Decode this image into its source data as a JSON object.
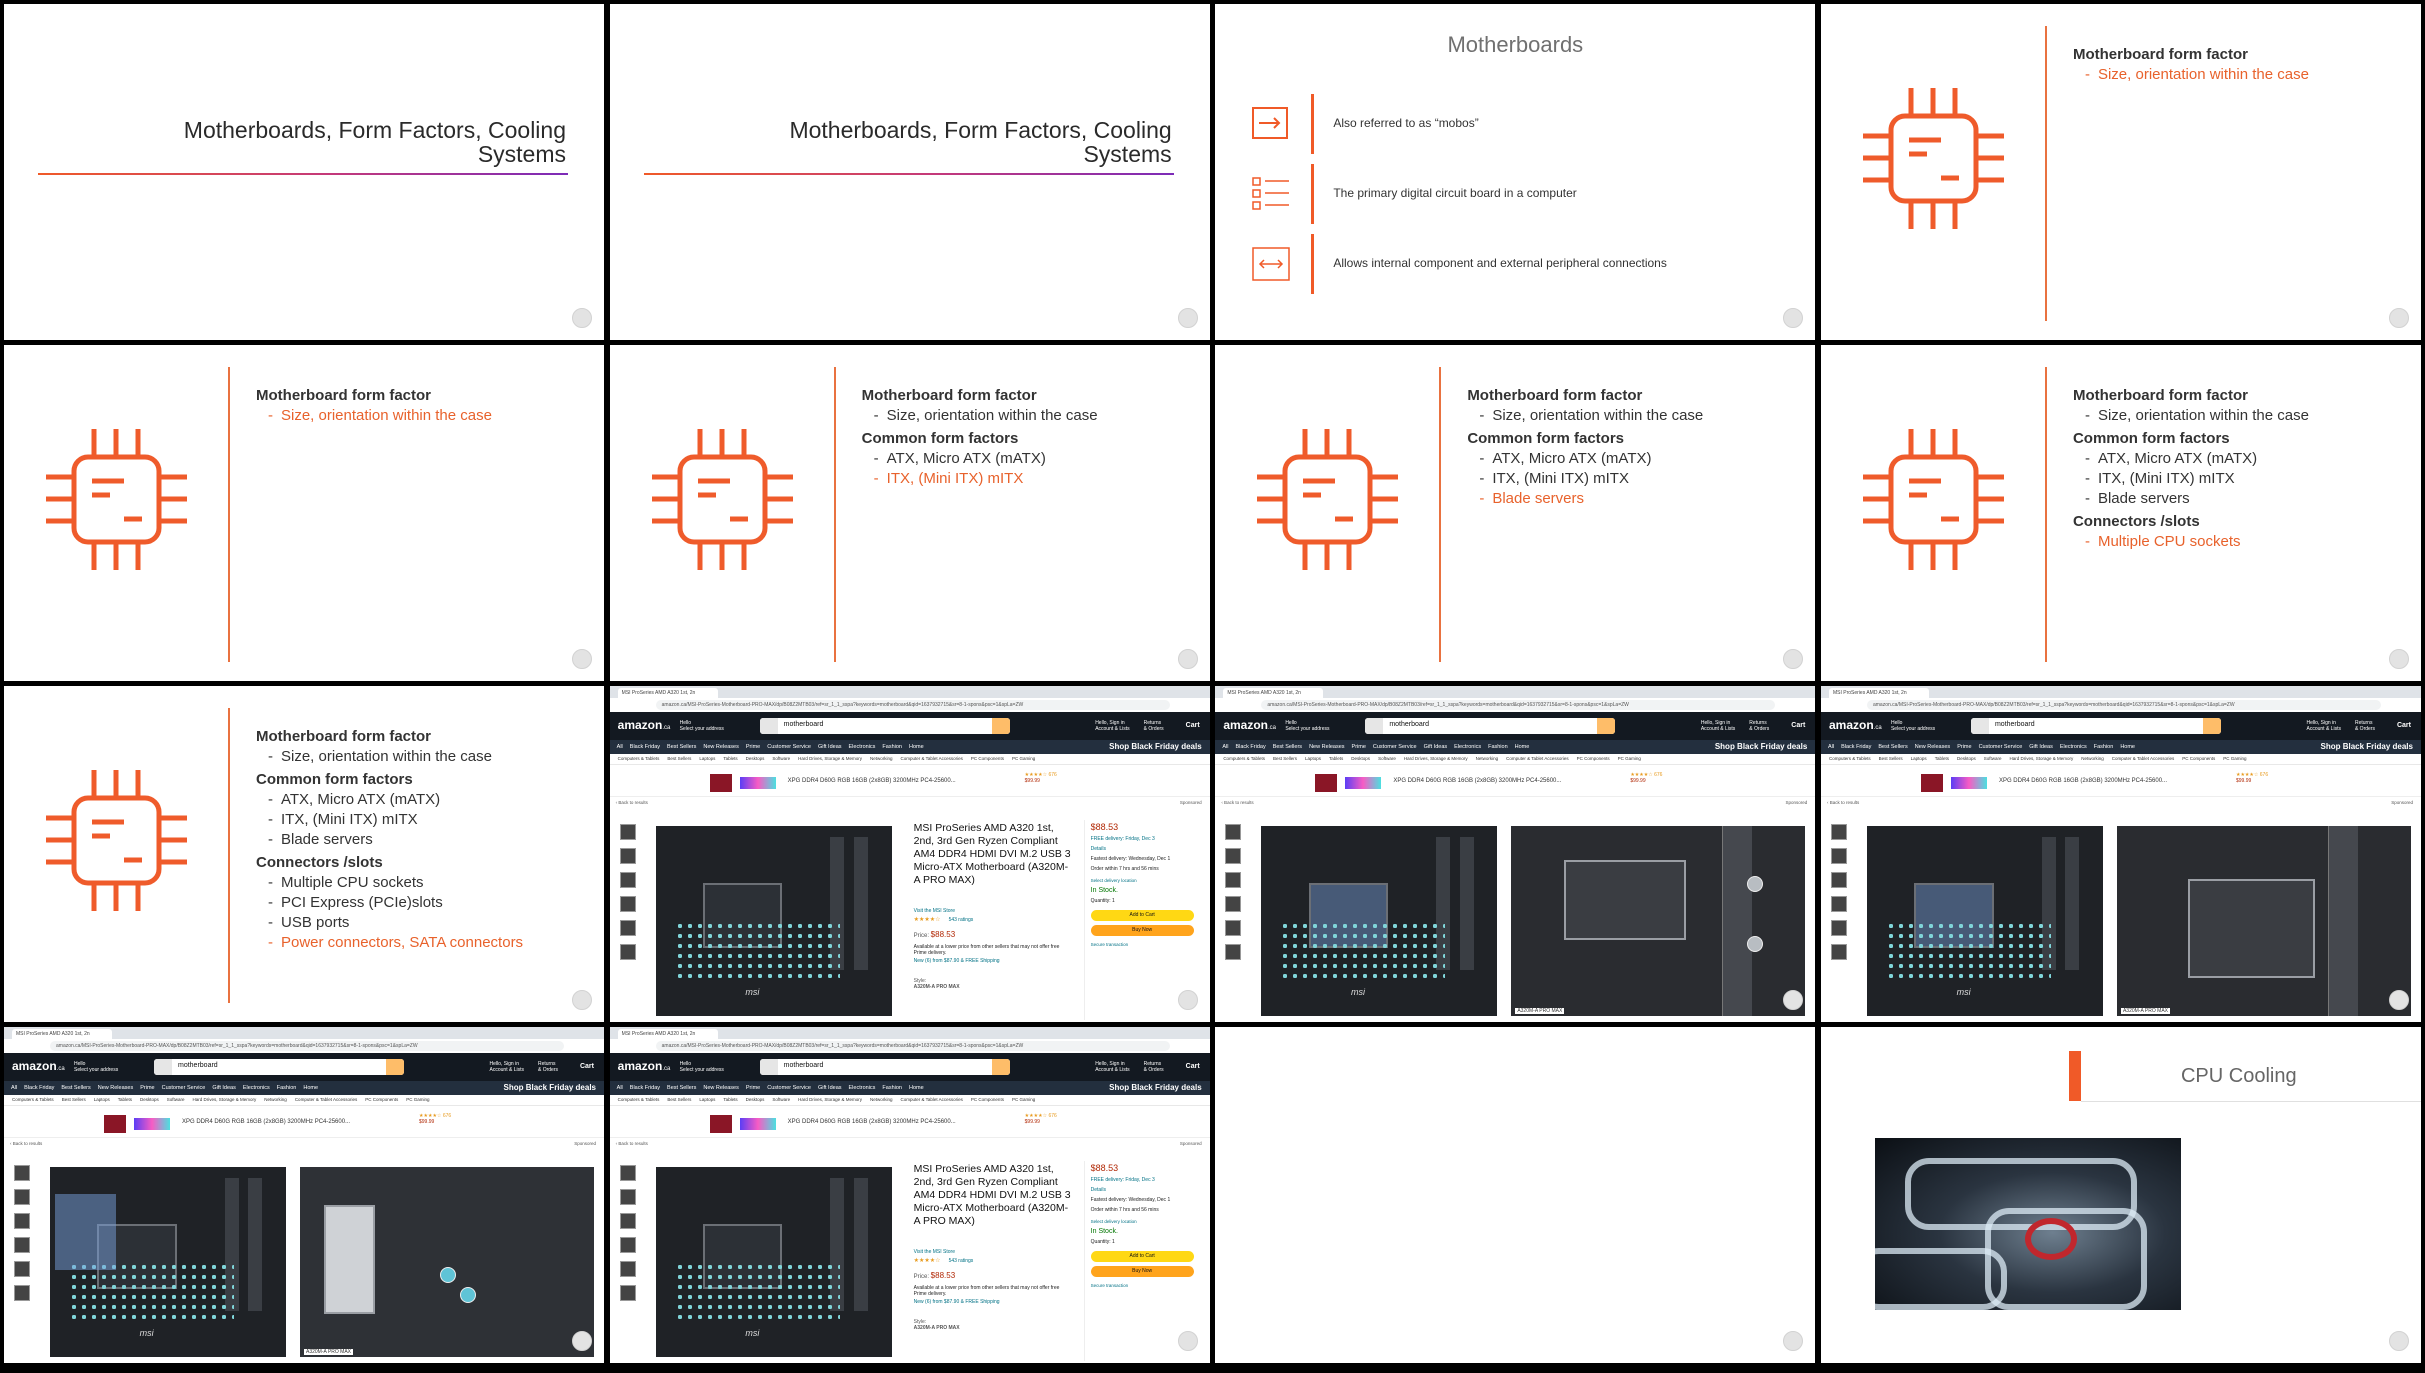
{
  "slides": {
    "title1": {
      "title": "Motherboards, Form Factors, Cooling Systems"
    },
    "title2": {
      "title": "Motherboards, Form Factors, Cooling Systems"
    },
    "motherboards": {
      "title": "Motherboards",
      "rows": [
        {
          "text": "Also referred to as “mobos”",
          "icon": "arrow-into-box-icon"
        },
        {
          "text": "The primary digital circuit board in a computer",
          "icon": "checklist-icon"
        },
        {
          "text": "Allows internal component and external peripheral connections",
          "icon": "double-arrow-icon"
        }
      ]
    },
    "bullets": {
      "h_form": "Motherboard form factor",
      "i_size": "Size, orientation within the case",
      "h_common": "Common form factors",
      "i_atx": "ATX, Micro ATX (mATX)",
      "i_itx": "ITX, (Mini ITX) mITX",
      "i_blade": "Blade servers",
      "h_conn": "Connectors /slots",
      "i_cpu": "Multiple CPU sockets",
      "i_pcie": "PCI Express (PCIe)slots",
      "i_usb": "USB ports",
      "i_power": "Power connectors, SATA connectors"
    },
    "cpu_cooling": {
      "title": "CPU Cooling"
    }
  },
  "browser": {
    "tab_title": "MSI ProSeries AMD A320 1st, 2n",
    "url": "amazon.ca/MSI-ProSeries-Motherboard-PRO-MAX/dp/B08Z2MTB03/ref=sr_1_1_sspa?keywords=motherboard&qid=1637932715&sr=8-1-spons&psc=1&spLa=ZW",
    "logo": "amazon",
    "logo_suffix": ".ca",
    "deliver_line1": "Hello",
    "deliver_line2": "Select your address",
    "search_category": "All",
    "search_query": "motherboard",
    "account_line1": "Hello, Sign in",
    "account_line2": "Account & Lists",
    "returns_line1": "Returns",
    "returns_line2": "& Orders",
    "cart": "Cart",
    "nav": [
      "All",
      "Black Friday",
      "Best Sellers",
      "New Releases",
      "Prime",
      "Customer Service",
      "Gift Ideas",
      "Electronics",
      "Fashion",
      "Home"
    ],
    "nav_deals": "Shop Black Friday deals",
    "subnav": [
      "Computers & Tablets",
      "Best Sellers",
      "Laptops",
      "Tablets",
      "Desktops",
      "Software",
      "Hard Drives, Storage & Memory",
      "Networking",
      "Computer & Tablet Accessories",
      "PC Components",
      "PC Gaming"
    ],
    "ad_text": "XPG DDR4 D60G RGB 16GB (2x8GB) 3200MHz PC4-25600...",
    "ad_rating_count": "676",
    "ad_price": "$99.99",
    "back": "‹ Back to results",
    "sponsored": "Sponsored",
    "product_title": "MSI ProSeries AMD A320 1st, 2nd, 3rd Gen Ryzen Compliant AM4 DDR4 HDMI DVI M.2 USB 3 Micro-ATX Motherboard (A320M-A PRO MAX)",
    "store": "Visit the MSI Store",
    "ratings": "543 ratings",
    "price_label": "Price:",
    "price": "$88.53",
    "avail_note": "Available at a lower price from other sellers that may not offer free Prime delivery.",
    "new_from": "New (6) from $87.90 & FREE Shipping",
    "style_label": "Style:",
    "style_value": "A320M-A PRO MAX",
    "board_label": "msi",
    "zoom_label": "A320M-A PRO MAX",
    "buy_price": "$88.53",
    "free_delivery": "FREE delivery: Friday, Dec 3",
    "details": "Details",
    "fastest": "Fastest delivery: Wednesday, Dec 1",
    "order_within": "Order within 7 hrs and 56 mins",
    "delivery_loc": "Select delivery location",
    "stock": "In Stock.",
    "quantity": "Quantity: 1",
    "add_to_cart": "Add to Cart",
    "buy_now": "Buy Now",
    "secure": "Secure transaction"
  },
  "colors": {
    "accent": "#f05a28",
    "highlight": "#e8622c",
    "amazon_dark": "#131921",
    "amazon_nav": "#232f3e"
  }
}
